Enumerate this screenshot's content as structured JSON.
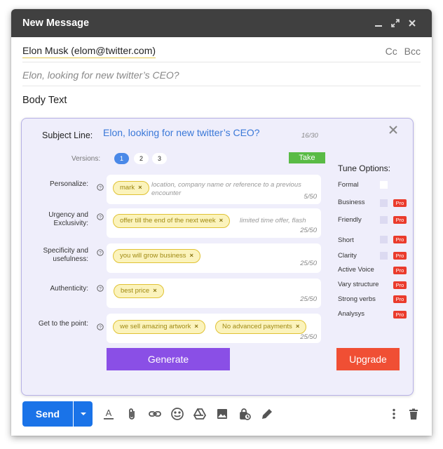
{
  "window": {
    "title": "New Message"
  },
  "compose": {
    "to": "Elon Musk  (elom@twitter.com)",
    "cc": "Cc",
    "bcc": "Bcc",
    "subject_placeholder": "Elon, looking for new twitter’s CEO?",
    "body": "Body Text"
  },
  "panel": {
    "subject_label": "Subject Line:",
    "subject_value": "Elon, looking for new twitter’s CEO?",
    "subject_count": "16/30",
    "versions_label": "Versions:",
    "versions": [
      "1",
      "2",
      "3"
    ],
    "active_version": "1",
    "take_label": "Take",
    "fields": [
      {
        "label": "Personalize:",
        "chips": [
          "mark"
        ],
        "placeholder": "location, company name or reference to a previous encounter",
        "count": "5/50"
      },
      {
        "label": "Urgency and Exclusivity:",
        "chips": [
          "offer till the end of the next week"
        ],
        "placeholder": "limited time offer, flash",
        "count": "25/50"
      },
      {
        "label": "Specificity and usefulness:",
        "chips": [
          "you will grow business"
        ],
        "placeholder": "",
        "count": "25/50"
      },
      {
        "label": "Authenticity:",
        "chips": [
          "best price"
        ],
        "placeholder": "",
        "count": "25/50"
      },
      {
        "label": "Get to the point:",
        "chips": [
          "we sell amazing artwork",
          "No advanced payments"
        ],
        "placeholder": "",
        "count": "25/50"
      }
    ],
    "generate_label": "Generate",
    "upgrade_label": "Upgrade",
    "tune_title": "Tune Options:",
    "tune_options": [
      {
        "label": "Formal",
        "checkbox": true,
        "locked": false,
        "pro": false
      },
      {
        "label": "Business",
        "checkbox": true,
        "locked": true,
        "pro": true
      },
      {
        "label": "Friendly",
        "checkbox": true,
        "locked": true,
        "pro": true
      },
      {
        "label": "Short",
        "checkbox": true,
        "locked": true,
        "pro": true
      },
      {
        "label": "Clarity",
        "checkbox": true,
        "locked": true,
        "pro": true
      },
      {
        "label": "Active Voice",
        "checkbox": false,
        "locked": true,
        "pro": true
      },
      {
        "label": "Vary structure",
        "checkbox": false,
        "locked": true,
        "pro": true
      },
      {
        "label": "Strong verbs",
        "checkbox": false,
        "locked": true,
        "pro": true
      },
      {
        "label": "Analysys",
        "checkbox": false,
        "locked": true,
        "pro": true
      }
    ],
    "pro_badge": "Pro",
    "chip_remove": "×"
  },
  "toolbar": {
    "send_label": "Send",
    "icons": [
      "format-text-icon",
      "attach-icon",
      "link-icon",
      "emoji-icon",
      "drive-icon",
      "image-icon",
      "confidential-icon",
      "signature-icon",
      "more-options-icon",
      "delete-icon"
    ]
  },
  "colors": {
    "accent": "#1a73e8",
    "panel_bg": "#efeefb",
    "chip_bg": "#fbf3bc",
    "generate": "#8a4fe6",
    "upgrade": "#f04f34",
    "take": "#59bb45",
    "pro": "#ea3b2c"
  }
}
